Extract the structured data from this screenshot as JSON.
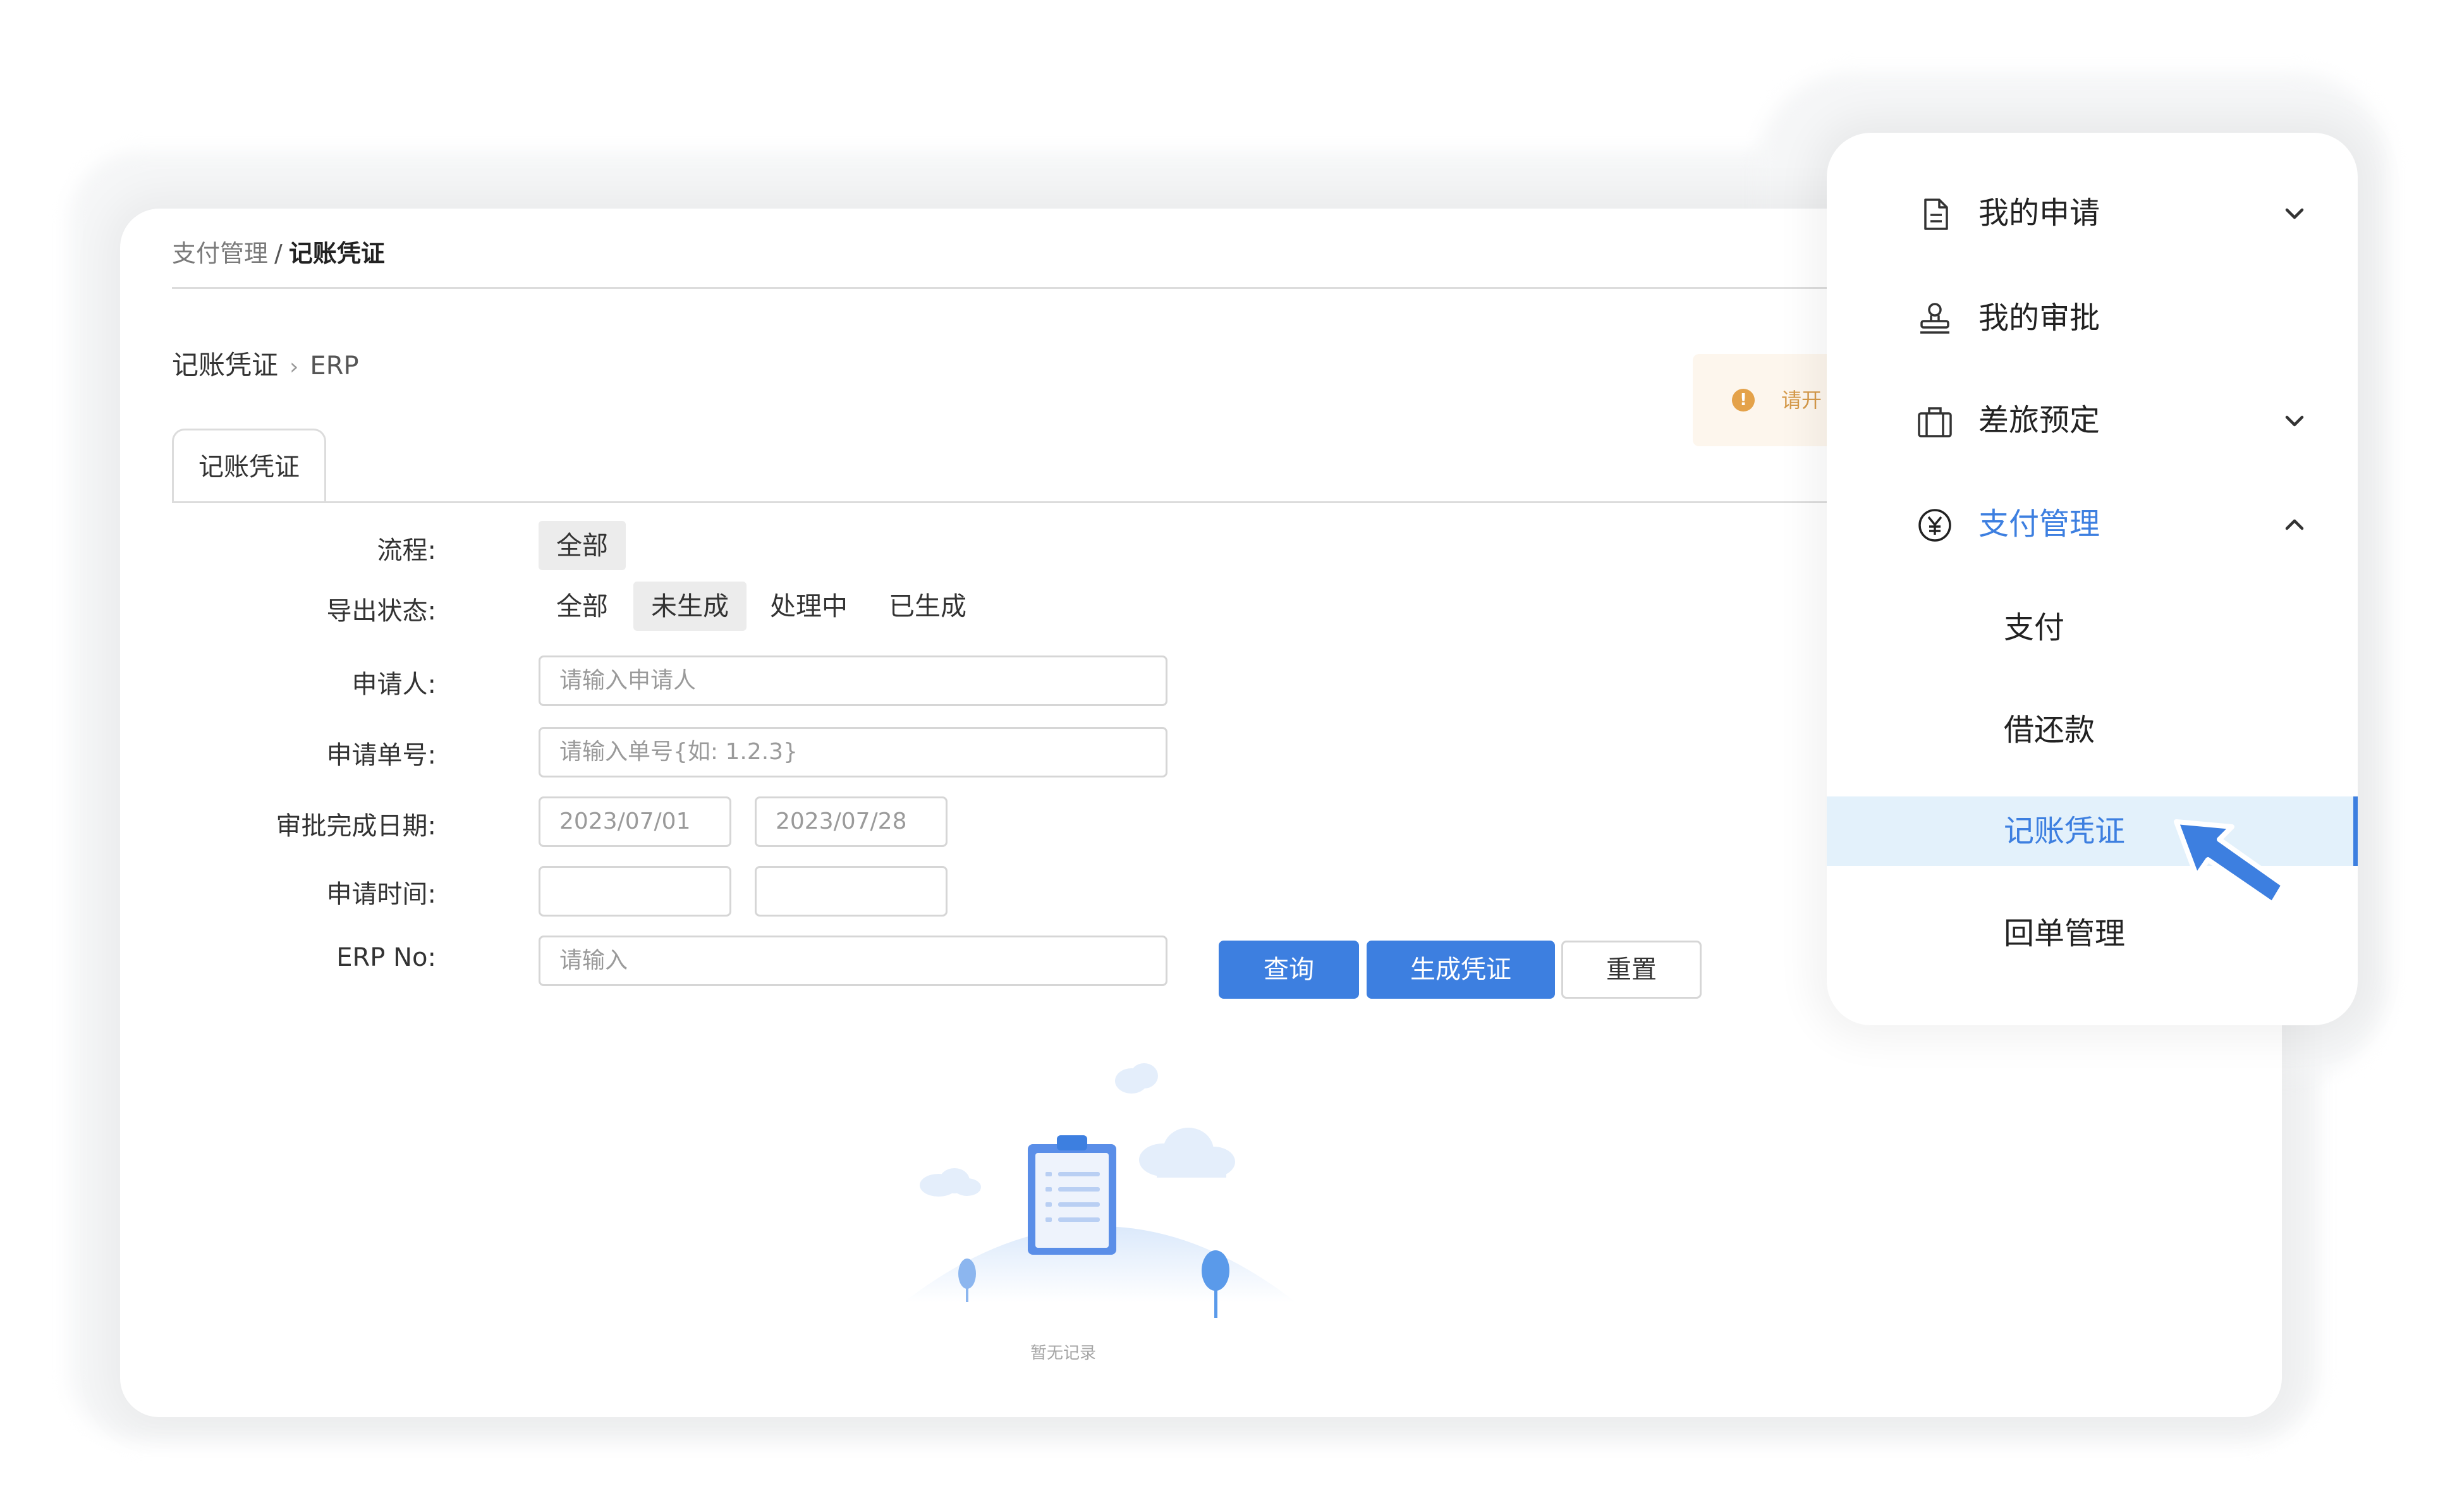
{
  "breadcrumb": {
    "parent": "支付管理",
    "separator": "/",
    "current": "记账凭证"
  },
  "subcrumb": {
    "title": "记账凭证",
    "erp": "ERP"
  },
  "alert": {
    "text": "请开"
  },
  "tab": {
    "label": "记账凭证"
  },
  "filters": {
    "process": {
      "label": "流程:",
      "options": [
        "全部"
      ],
      "selected": "全部"
    },
    "export_status": {
      "label": "导出状态:",
      "options": [
        "全部",
        "未生成",
        "处理中",
        "已生成"
      ],
      "selected": "未生成"
    },
    "applicant": {
      "label": "申请人:",
      "placeholder": "请输入申请人"
    },
    "request_no": {
      "label": "申请单号:",
      "placeholder": "请输入单号{如: 1.2.3}"
    },
    "approval_date": {
      "label": "审批完成日期:",
      "start": "2023/07/01",
      "end": "2023/07/28"
    },
    "apply_time": {
      "label": "申请时间:",
      "start": "",
      "end": ""
    },
    "erp_no": {
      "label": "ERP No:",
      "placeholder": "请输入"
    }
  },
  "actions": {
    "query": "查询",
    "generate": "生成凭证",
    "reset": "重置"
  },
  "empty": {
    "text": "暂无记录"
  },
  "menu": {
    "items": [
      {
        "label": "我的申请",
        "icon": "document-icon",
        "expandable": true
      },
      {
        "label": "我的审批",
        "icon": "stamp-icon",
        "expandable": false
      },
      {
        "label": "差旅预定",
        "icon": "suitcase-icon",
        "expandable": true
      },
      {
        "label": "支付管理",
        "icon": "yen-icon",
        "expandable": true,
        "expanded": true
      }
    ],
    "sub_items": [
      "支付",
      "借还款",
      "记账凭证",
      "回单管理"
    ],
    "selected_sub": "记账凭证"
  },
  "colors": {
    "primary": "#3d7fe0",
    "selected_bg": "#e3f1fb",
    "alert_bg": "#fdf6ed",
    "alert_icon": "#e4a24a"
  }
}
